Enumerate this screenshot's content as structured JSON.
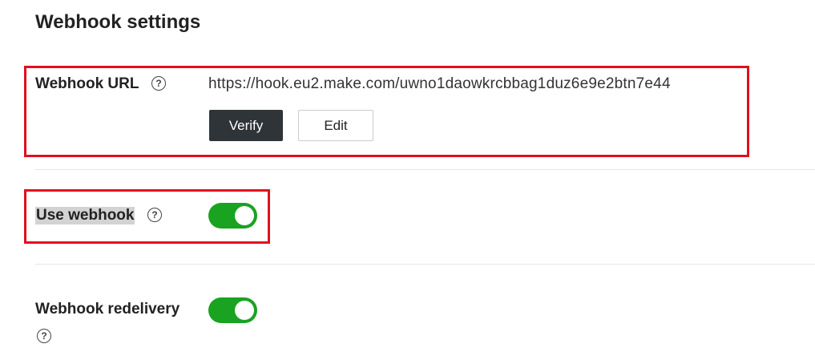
{
  "page": {
    "title": "Webhook settings"
  },
  "webhook_url": {
    "label": "Webhook URL",
    "help_icon": "question-circle-icon",
    "value": "https://hook.eu2.make.com/uwno1daowkrcbbag1duz6e9e2btn7e44",
    "verify_label": "Verify",
    "edit_label": "Edit"
  },
  "use_webhook": {
    "label": "Use webhook",
    "help_icon": "question-circle-icon",
    "enabled": true
  },
  "webhook_redelivery": {
    "label": "Webhook redelivery",
    "help_icon": "question-circle-icon",
    "enabled": true
  },
  "colors": {
    "toggle_on": "#1aa221",
    "primary_button": "#2f3439",
    "highlight_box": "#e0101f"
  },
  "help_glyph": "?"
}
